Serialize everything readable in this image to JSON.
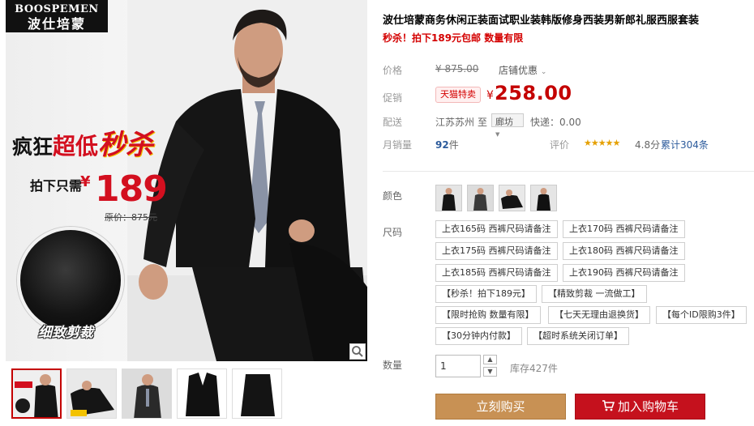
{
  "gallery": {
    "brand_line1": "BOOSPEMEN",
    "brand_line2": "波仕培蒙",
    "promo_part1": "疯狂",
    "promo_part2": "超低",
    "promo_part3": "秒杀",
    "promo_only_label": "拍下只需",
    "promo_yen": "¥",
    "promo_price": "189",
    "promo_orig_label": "原价：",
    "promo_orig_price": "875元",
    "fabric_caption": "细致剪裁"
  },
  "product": {
    "title": "波仕培蒙商务休闲正装面试职业装韩版修身西装男新郎礼服西服套装",
    "subtitle": "秒杀！拍下189元包邮 数量有限",
    "price_label": "价格",
    "price_original": "¥ 875.00",
    "store_discount": "店铺优惠",
    "promo_label": "促销",
    "promo_badge": "天猫特卖",
    "promo_yen": "¥",
    "promo_price": "258.00",
    "shipping_label": "配送",
    "shipping_from": "江苏苏州",
    "shipping_to_word": "至",
    "shipping_dest": "廊坊",
    "shipping_fee": "快递：0.00",
    "monthly_sales_label": "月销量",
    "monthly_sales_value": "92",
    "monthly_sales_unit": "件",
    "rating_label": "评价",
    "rating_stars": "★★★★★",
    "rating_score": "4.8分",
    "rating_total": "累计304条",
    "color_label": "颜色",
    "size_label": "尺码",
    "sizes": [
      "上衣165码 西裤尺码请备注",
      "上衣170码 西裤尺码请备注",
      "上衣175码 西裤尺码请备注",
      "上衣180码 西裤尺码请备注",
      "上衣185码 西裤尺码请备注",
      "上衣190码 西裤尺码请备注"
    ],
    "tags": [
      "【秒杀！拍下189元】",
      "【精致剪裁 一流做工】",
      "【限时抢购 数量有限】",
      "【七天无理由退换货】",
      "【每个ID限购3件】",
      "【30分钟内付款】",
      "【超时系统关闭订单】"
    ],
    "qty_label": "数量",
    "qty_value": "1",
    "stock": "库存427件",
    "buy_now": "立刻购买",
    "add_cart": "加入购物车"
  },
  "colors": {
    "accent": "#c40000",
    "buy_btn": "#c89154",
    "cart_btn": "#c5111d"
  }
}
